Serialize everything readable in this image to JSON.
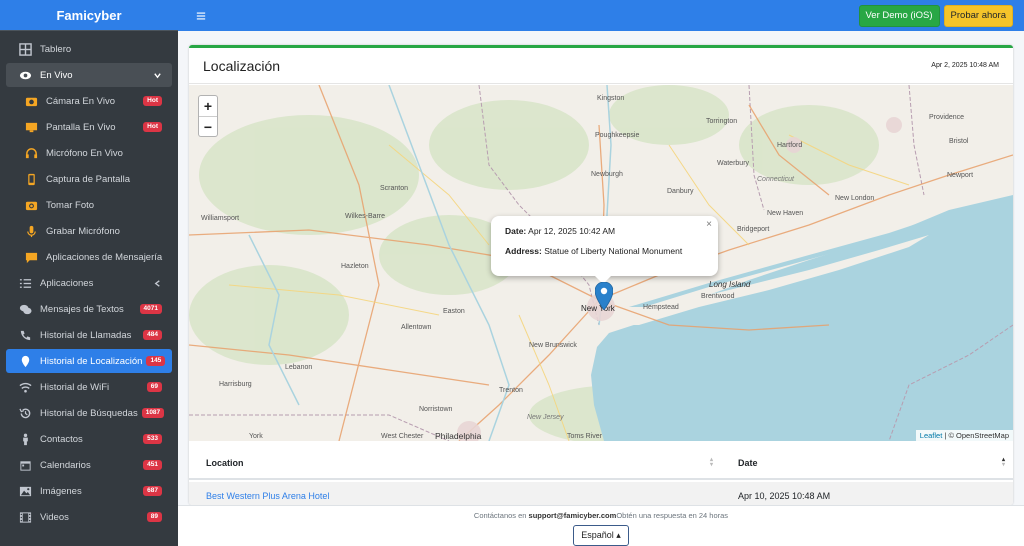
{
  "brand": "Famicyber",
  "sidebar": {
    "items": [
      {
        "label": "Tablero",
        "icon": "dashboard-icon"
      },
      {
        "label": "En Vivo",
        "icon": "eye-icon"
      },
      {
        "label": "Cámara En Vivo",
        "icon": "camera-icon",
        "badge": "Hot"
      },
      {
        "label": "Pantalla En Vivo",
        "icon": "monitor-icon",
        "badge": "Hot"
      },
      {
        "label": "Micrófono En Vivo",
        "icon": "headphones-icon"
      },
      {
        "label": "Captura de Pantalla",
        "icon": "phone-icon"
      },
      {
        "label": "Tomar Foto",
        "icon": "photo-camera-icon"
      },
      {
        "label": "Grabar Micrófono",
        "icon": "microphone-icon"
      },
      {
        "label": "Aplicaciones de Mensajería",
        "icon": "chat-icon"
      },
      {
        "label": "Aplicaciones",
        "icon": "list-icon"
      },
      {
        "label": "Mensajes de Textos",
        "icon": "comments-icon",
        "badge": "4071"
      },
      {
        "label": "Historial de Llamadas",
        "icon": "phone-call-icon",
        "badge": "484"
      },
      {
        "label": "Historial de Localización",
        "icon": "location-pin-icon",
        "badge": "145"
      },
      {
        "label": "Historial de WiFi",
        "icon": "wifi-icon",
        "badge": "69"
      },
      {
        "label": "Historial de Búsquedas",
        "icon": "history-icon",
        "badge": "1087"
      },
      {
        "label": "Contactos",
        "icon": "person-icon",
        "badge": "533"
      },
      {
        "label": "Calendarios",
        "icon": "calendar-icon",
        "badge": "451"
      },
      {
        "label": "Imágenes",
        "icon": "image-icon",
        "badge": "687"
      },
      {
        "label": "Videos",
        "icon": "film-icon",
        "badge": "89"
      }
    ]
  },
  "topbar": {
    "demo_label": "Ver Demo (iOS)",
    "try_label": "Probar ahora"
  },
  "card": {
    "title": "Localización",
    "date": "Apr 2, 2025 10:48 AM"
  },
  "map": {
    "zoom_in": "+",
    "zoom_out": "−",
    "popup": {
      "date_label": "Date:",
      "date_value": "Apr 12, 2025 10:42 AM",
      "address_label": "Address:",
      "address_value": "Statue of Liberty National Monument",
      "close": "×"
    },
    "attribution_leaflet": "Leaflet",
    "attribution_osm": "| © OpenStreetMap",
    "place_labels": [
      "Kingston",
      "Poughkeepsie",
      "Torrington",
      "Hartford",
      "Providence",
      "Scranton",
      "Newburgh",
      "Danbury",
      "Waterbury",
      "Wilkes-Barre",
      "Williamsport",
      "New Haven",
      "New London",
      "Hazleton",
      "Bridgeport",
      "Long Island",
      "Allentown",
      "Easton",
      "New York",
      "Hempstead",
      "Brentwood",
      "Harrisburg",
      "Lebanon",
      "New Brunswick",
      "Trenton",
      "Norristown",
      "West Chester",
      "Philadelphia",
      "Toms River",
      "New Jersey",
      "Newport",
      "Bristol",
      "Connecticut",
      "York"
    ]
  },
  "table": {
    "col_location": "Location",
    "col_date": "Date",
    "rows": [
      {
        "location": "Best Western Plus Arena Hotel",
        "date": "Apr 10, 2025 10:48 AM"
      }
    ]
  },
  "footer": {
    "text_prefix": "Contáctanos en ",
    "email": "support@famicyber.com",
    "text_suffix": "Obtén una respuesta en 24 horas",
    "language": "Español ▴"
  }
}
